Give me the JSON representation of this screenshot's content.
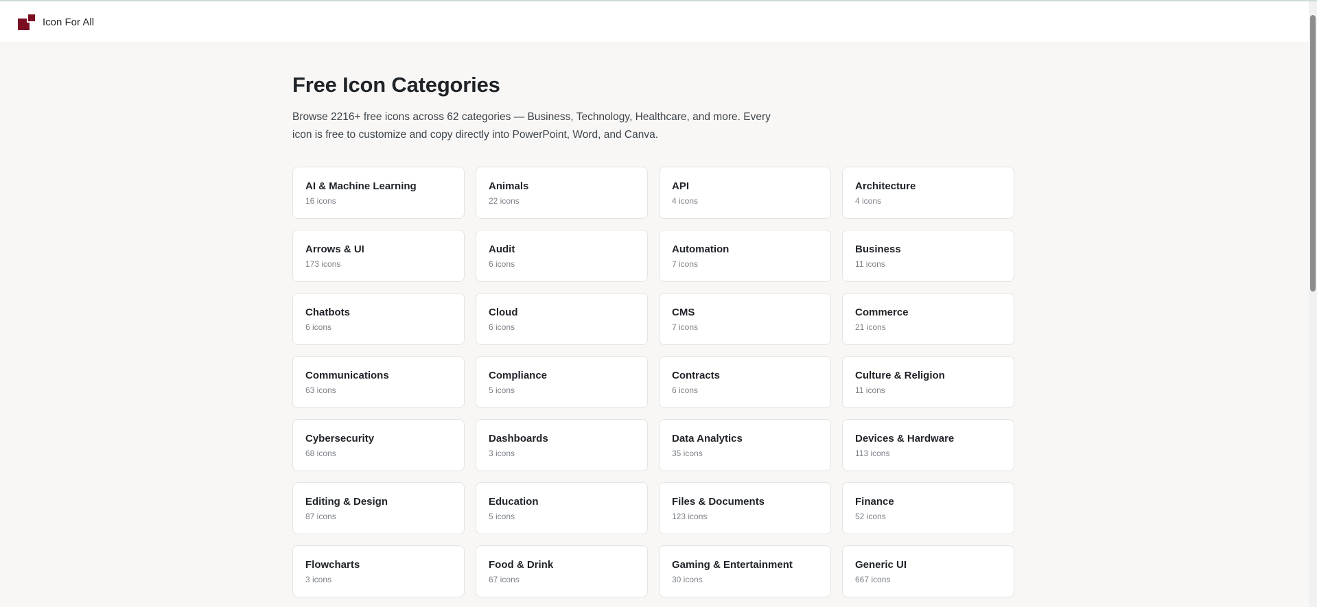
{
  "header": {
    "brand": "Icon For All",
    "logo_icon": "icon-for-all-logo",
    "brand_color": "#7a0f22"
  },
  "main": {
    "title": "Free Icon Categories",
    "intro": "Browse 2216+ free icons across 62 categories — Business, Technology, Healthcare, and more. Every icon is free to customize and copy directly into PowerPoint, Word, and Canva."
  },
  "categories": [
    {
      "name": "AI & Machine Learning",
      "count": "16 icons"
    },
    {
      "name": "Animals",
      "count": "22 icons"
    },
    {
      "name": "API",
      "count": "4 icons"
    },
    {
      "name": "Architecture",
      "count": "4 icons"
    },
    {
      "name": "Arrows & UI",
      "count": "173 icons"
    },
    {
      "name": "Audit",
      "count": "6 icons"
    },
    {
      "name": "Automation",
      "count": "7 icons"
    },
    {
      "name": "Business",
      "count": "11 icons"
    },
    {
      "name": "Chatbots",
      "count": "6 icons"
    },
    {
      "name": "Cloud",
      "count": "6 icons"
    },
    {
      "name": "CMS",
      "count": "7 icons"
    },
    {
      "name": "Commerce",
      "count": "21 icons"
    },
    {
      "name": "Communications",
      "count": "63 icons"
    },
    {
      "name": "Compliance",
      "count": "5 icons"
    },
    {
      "name": "Contracts",
      "count": "6 icons"
    },
    {
      "name": "Culture & Religion",
      "count": "11 icons"
    },
    {
      "name": "Cybersecurity",
      "count": "68 icons"
    },
    {
      "name": "Dashboards",
      "count": "3 icons"
    },
    {
      "name": "Data Analytics",
      "count": "35 icons"
    },
    {
      "name": "Devices & Hardware",
      "count": "113 icons"
    },
    {
      "name": "Editing & Design",
      "count": "87 icons"
    },
    {
      "name": "Education",
      "count": "5 icons"
    },
    {
      "name": "Files & Documents",
      "count": "123 icons"
    },
    {
      "name": "Finance",
      "count": "52 icons"
    },
    {
      "name": "Flowcharts",
      "count": "3 icons"
    },
    {
      "name": "Food & Drink",
      "count": "67 icons"
    },
    {
      "name": "Gaming & Entertainment",
      "count": "30 icons"
    },
    {
      "name": "Generic UI",
      "count": "667 icons"
    }
  ]
}
